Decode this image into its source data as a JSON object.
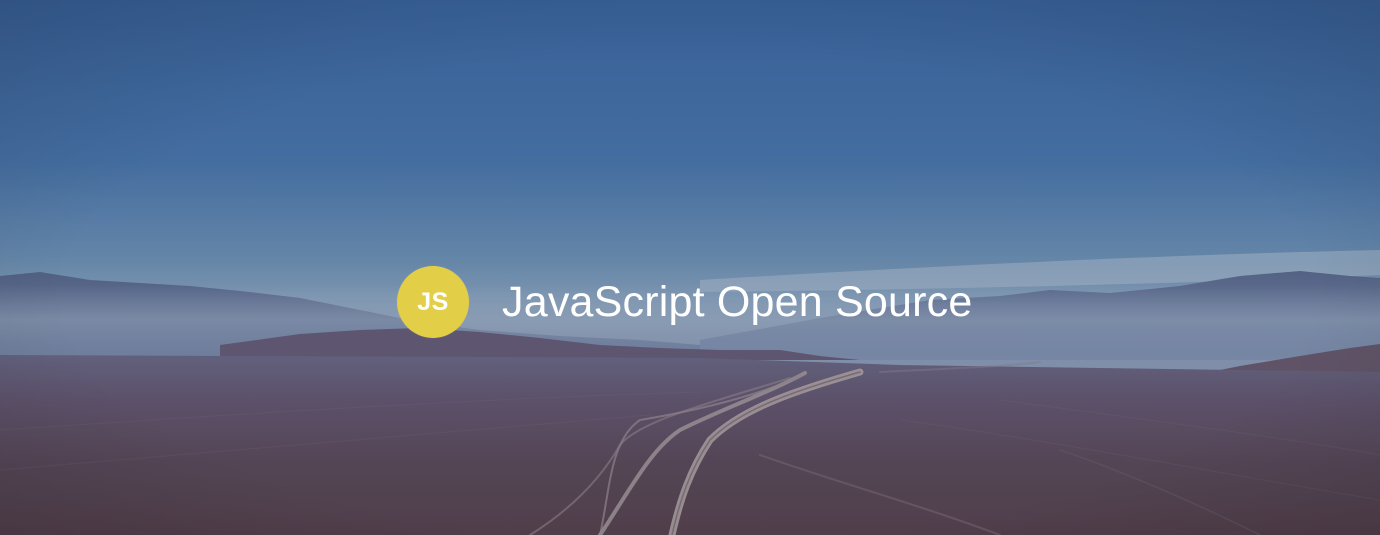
{
  "hero": {
    "logo_text": "JS",
    "title": "JavaScript Open Source"
  },
  "colors": {
    "sky_top": "#3f6ca6",
    "sky_horizon": "#8ba7bf",
    "mountains": "#5d6a86",
    "desert": "#5b4a55",
    "logo_yellow": "#e3ce47",
    "title_text": "#ffffff"
  },
  "icons": {
    "logo": "javascript-logo-icon"
  }
}
